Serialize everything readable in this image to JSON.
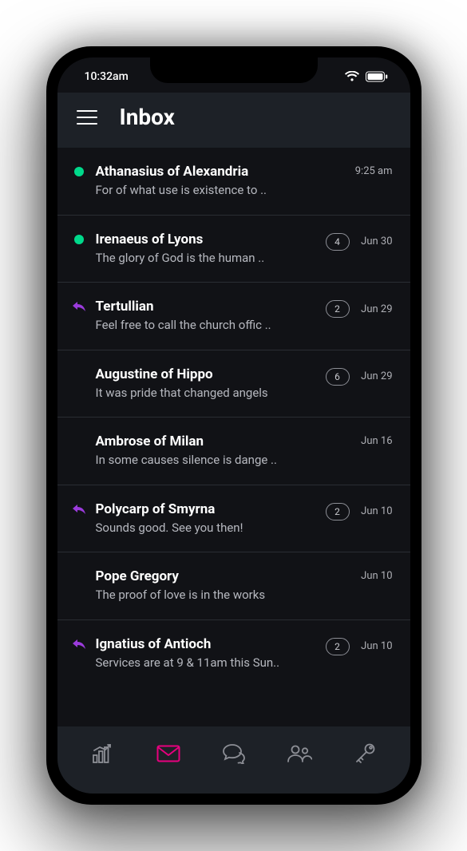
{
  "status": {
    "time": "10:32am"
  },
  "header": {
    "title": "Inbox"
  },
  "colors": {
    "unread_dot": "#00d98b",
    "reply_icon": "#9b3bdc",
    "nav_active": "#e6007e",
    "nav_inactive": "#8d8f96"
  },
  "messages": [
    {
      "indicator": "dot",
      "sender": "Athanasius of Alexandria",
      "preview": "For of what use is existence to ..",
      "count": null,
      "time": "9:25 am"
    },
    {
      "indicator": "dot",
      "sender": "Irenaeus of Lyons",
      "preview": "The glory of God is the human ..",
      "count": 4,
      "time": "Jun 30"
    },
    {
      "indicator": "reply",
      "sender": "Tertullian",
      "preview": "Feel free to call the church offic ..",
      "count": 2,
      "time": "Jun 29"
    },
    {
      "indicator": "none",
      "sender": "Augustine of Hippo",
      "preview": "It was pride that changed angels",
      "count": 6,
      "time": "Jun 29"
    },
    {
      "indicator": "none",
      "sender": "Ambrose of Milan",
      "preview": "In some causes silence is dange ..",
      "count": null,
      "time": "Jun 16"
    },
    {
      "indicator": "reply",
      "sender": "Polycarp of Smyrna",
      "preview": "Sounds good. See you then!",
      "count": 2,
      "time": "Jun 10"
    },
    {
      "indicator": "none",
      "sender": "Pope Gregory",
      "preview": "The proof of love is in the works",
      "count": null,
      "time": "Jun 10"
    },
    {
      "indicator": "reply",
      "sender": "Ignatius of Antioch",
      "preview": "Services are at 9 & 11am this Sun..",
      "count": 2,
      "time": "Jun 10"
    }
  ],
  "nav": {
    "items": [
      {
        "icon": "stats-icon",
        "active": false
      },
      {
        "icon": "mail-icon",
        "active": true
      },
      {
        "icon": "chat-icon",
        "active": false
      },
      {
        "icon": "people-icon",
        "active": false
      },
      {
        "icon": "key-icon",
        "active": false
      }
    ]
  }
}
